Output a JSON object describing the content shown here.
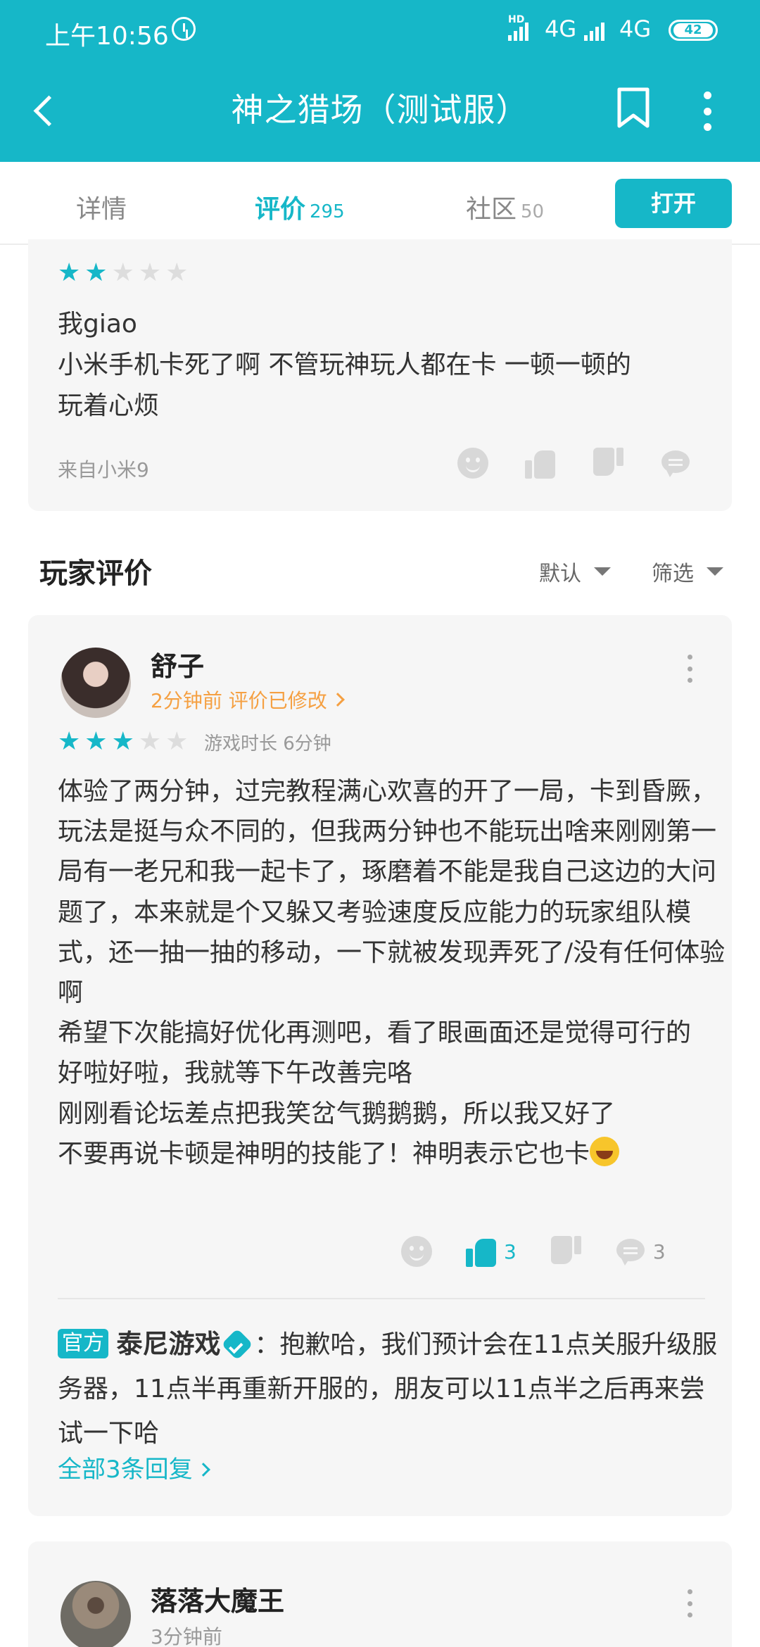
{
  "status_bar": {
    "time": "上午10:56",
    "network1": "4G",
    "network2": "4G",
    "hd_label": "HD",
    "battery": "42"
  },
  "app_bar": {
    "title": "神之猎场（测试服）"
  },
  "tabs": {
    "items": [
      {
        "label": "详情",
        "count": ""
      },
      {
        "label": "评价",
        "count": "295"
      },
      {
        "label": "社区",
        "count": "50"
      }
    ],
    "active_index": 1,
    "open_button": "打开"
  },
  "prev_review": {
    "rating": 2,
    "max_rating": 5,
    "body": "我giao\n小米手机卡死了啊 不管玩神玩人都在卡 一顿一顿的玩着心烦",
    "line1": "我giao",
    "line2": "小米手机卡死了啊 不管玩神玩人都在卡 一顿一顿的",
    "line3": "玩着心烦",
    "device": "来自小米9"
  },
  "section": {
    "title": "玩家评价",
    "sort_label": "默认",
    "filter_label": "筛选"
  },
  "review": {
    "username": "舒子",
    "meta": "2分钟前 评价已修改",
    "rating": 3,
    "max_rating": 5,
    "playtime": "游戏时长 6分钟",
    "body": "体验了两分钟，过完教程满心欢喜的开了一局，卡到昏厥，玩法是挺与众不同的，但我两分钟也不能玩出啥来刚刚第一局有一老兄和我一起卡了，琢磨着不能是我自己这边的大问题了，本来就是个又躲又考验速度反应能力的玩家组队模式，还一抽一抽的移动，一下就被发现弄死了/没有任何体验啊\n希望下次能搞好优化再测吧，看了眼画面还是觉得可行的\n好啦好啦，我就等下午改善完咯\n刚刚看论坛差点把我笑岔气鹅鹅鹅，所以我又好了\n不要再说卡顿是神明的技能了！神明表示它也卡",
    "likes": "3",
    "comments": "3",
    "reply": {
      "badge": "官方",
      "name": "泰尼游戏",
      "text": "：抱歉哈，我们预计会在11点关服升级服务器，11点半再重新开服的，朋友可以11点半之后再来尝试一下哈"
    },
    "more_replies": "全部3条回复"
  },
  "next_review": {
    "username": "落落大魔王",
    "meta": "3分钟前"
  },
  "colors": {
    "accent": "#16b7c8",
    "orange": "#f5a042"
  }
}
